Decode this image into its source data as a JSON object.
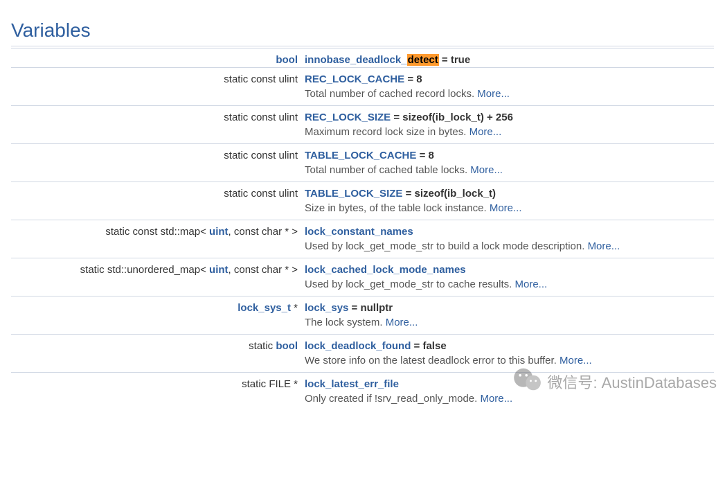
{
  "section_title": "Variables",
  "more_label": "More...",
  "rows": [
    {
      "type_prefix": "",
      "type_link": "bool",
      "type_suffix": "",
      "name_prefix": "innobase_deadlock_",
      "name_highlight": "detect",
      "name": "",
      "value": " = true",
      "desc": ""
    },
    {
      "type_prefix": "static const ulint",
      "type_link": "",
      "type_suffix": "",
      "name": "REC_LOCK_CACHE",
      "value": " = 8",
      "desc": "Total number of cached record locks. "
    },
    {
      "type_prefix": "static const ulint",
      "type_link": "",
      "type_suffix": "",
      "name": "REC_LOCK_SIZE",
      "value": " = sizeof(ib_lock_t) + 256",
      "desc": "Maximum record lock size in bytes. "
    },
    {
      "type_prefix": "static const ulint",
      "type_link": "",
      "type_suffix": "",
      "name": "TABLE_LOCK_CACHE",
      "value": " = 8",
      "desc": "Total number of cached table locks. "
    },
    {
      "type_prefix": "static const ulint",
      "type_link": "",
      "type_suffix": "",
      "name": "TABLE_LOCK_SIZE",
      "value": " = sizeof(ib_lock_t)",
      "desc": "Size in bytes, of the table lock instance. "
    },
    {
      "type_prefix": "static const std::map< ",
      "type_link": "uint",
      "type_suffix": ", const char * >",
      "name": "lock_constant_names",
      "value": "",
      "desc": "Used by lock_get_mode_str to build a lock mode description. "
    },
    {
      "type_prefix": "static std::unordered_map< ",
      "type_link": "uint",
      "type_suffix": ", const char * >",
      "name": "lock_cached_lock_mode_names",
      "value": "",
      "desc": "Used by lock_get_mode_str to cache results. "
    },
    {
      "type_prefix": "",
      "type_link": "lock_sys_t",
      "type_suffix": " *",
      "name": "lock_sys",
      "value": " = nullptr",
      "desc": "The lock system. "
    },
    {
      "type_prefix": "static ",
      "type_link": "bool",
      "type_suffix": "",
      "name": "lock_deadlock_found",
      "value": " = false",
      "desc": "We store info on the latest deadlock error to this buffer. "
    },
    {
      "type_prefix": "static FILE *",
      "type_link": "",
      "type_suffix": "",
      "name": "lock_latest_err_file",
      "value": "",
      "desc": "Only created if !srv_read_only_mode. "
    }
  ],
  "watermark": {
    "label": "微信号",
    "sep": ": ",
    "value": "AustinDatabases"
  }
}
